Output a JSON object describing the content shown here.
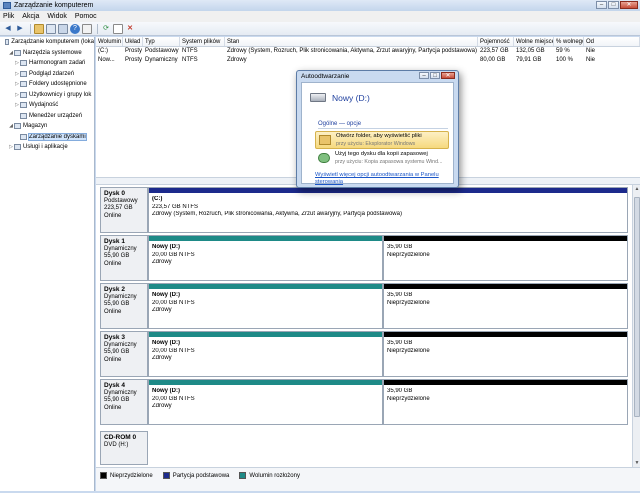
{
  "window": {
    "title": "Zarządzanie komputerem"
  },
  "menu": [
    "Plik",
    "Akcja",
    "Widok",
    "Pomoc"
  ],
  "toolbar": {
    "icons": [
      "back-icon",
      "forward-icon",
      "up-icon",
      "console-tree-icon",
      "properties-icon",
      "help-icon",
      "export-icon",
      "refresh-icon",
      "new-icon",
      "delete-icon"
    ]
  },
  "tree": {
    "items": [
      {
        "label": "Zarządzanie komputerem (loka",
        "indent": 0,
        "exp": ""
      },
      {
        "label": "Narzędzia systemowe",
        "indent": 1,
        "exp": "◢"
      },
      {
        "label": "Harmonogram zadań",
        "indent": 2,
        "exp": "▷"
      },
      {
        "label": "Podgląd zdarzeń",
        "indent": 2,
        "exp": "▷"
      },
      {
        "label": "Foldery udostępnione",
        "indent": 2,
        "exp": "▷"
      },
      {
        "label": "Użytkownicy i grupy lok",
        "indent": 2,
        "exp": "▷"
      },
      {
        "label": "Wydajność",
        "indent": 2,
        "exp": "▷"
      },
      {
        "label": "Menedżer urządzeń",
        "indent": 2,
        "exp": ""
      },
      {
        "label": "Magazyn",
        "indent": 1,
        "exp": "◢"
      },
      {
        "label": "Zarządzanie dyskami",
        "indent": 2,
        "exp": "",
        "selected": true
      },
      {
        "label": "Usługi i aplikacje",
        "indent": 1,
        "exp": "▷"
      }
    ]
  },
  "volumes": {
    "columns": [
      "Wolumin",
      "Układ",
      "Typ",
      "System plików",
      "Stan",
      "Pojemność",
      "Wolne miejsce",
      "% wolnego",
      "Od"
    ],
    "rows": [
      [
        "(C:)",
        "Prosty",
        "Podstawowy",
        "NTFS",
        "Zdrowy (System, Rozruch, Plik stronicowania, Aktywna, Zrzut awaryjny, Partycja podstawowa)",
        "223,57 GB",
        "132,05 GB",
        "59 %",
        "Nie"
      ],
      [
        "Now...",
        "Prosty",
        "Dynamiczny",
        "NTFS",
        "Zdrowy",
        "80,00 GB",
        "79,91 GB",
        "100 %",
        "Nie"
      ]
    ]
  },
  "disks": [
    {
      "name": "Dysk 0",
      "type": "Podstawowy",
      "size": "223,57 GB",
      "status": "Online",
      "partitions": [
        {
          "name": "(C:)",
          "fs": "223,57 GB NTFS",
          "state": "Zdrowy (System, Rozruch, Plik stronicowania, Aktywna, Zrzut awaryjny, Partycja podstawowa)",
          "kind": "primary",
          "share": 1.0
        }
      ]
    },
    {
      "name": "Dysk 1",
      "type": "Dynamiczny",
      "size": "55,90 GB",
      "status": "Online",
      "partitions": [
        {
          "name": "Nowy  (D:)",
          "fs": "20,00 GB NTFS",
          "state": "Zdrowy",
          "kind": "spanned",
          "share": 0.49
        },
        {
          "name": "",
          "fs": "35,90 GB",
          "state": "Nieprzydzielone",
          "kind": "unallocated",
          "share": 0.51
        }
      ]
    },
    {
      "name": "Dysk 2",
      "type": "Dynamiczny",
      "size": "55,90 GB",
      "status": "Online",
      "partitions": [
        {
          "name": "Nowy  (D:)",
          "fs": "20,00 GB NTFS",
          "state": "Zdrowy",
          "kind": "spanned",
          "share": 0.49
        },
        {
          "name": "",
          "fs": "35,90 GB",
          "state": "Nieprzydzielone",
          "kind": "unallocated",
          "share": 0.51
        }
      ]
    },
    {
      "name": "Dysk 3",
      "type": "Dynamiczny",
      "size": "55,90 GB",
      "status": "Online",
      "partitions": [
        {
          "name": "Nowy  (D:)",
          "fs": "20,00 GB NTFS",
          "state": "Zdrowy",
          "kind": "spanned",
          "share": 0.49
        },
        {
          "name": "",
          "fs": "35,90 GB",
          "state": "Nieprzydzielone",
          "kind": "unallocated",
          "share": 0.51
        }
      ]
    },
    {
      "name": "Dysk 4",
      "type": "Dynamiczny",
      "size": "55,90 GB",
      "status": "Online",
      "partitions": [
        {
          "name": "Nowy  (D:)",
          "fs": "20,00 GB NTFS",
          "state": "Zdrowy",
          "kind": "spanned",
          "share": 0.49
        },
        {
          "name": "",
          "fs": "35,90 GB",
          "state": "Nieprzydzielone",
          "kind": "unallocated",
          "share": 0.51
        }
      ]
    },
    {
      "name": "CD-ROM 0",
      "type": "DVD (H:)",
      "size": "",
      "status": "",
      "partitions": []
    }
  ],
  "legend": [
    {
      "label": "Nieprzydzielone",
      "color": "#000000"
    },
    {
      "label": "Partycja podstawowa",
      "color": "#1c2a8c"
    },
    {
      "label": "Wolumin rozłożony",
      "color": "#1e8a87"
    }
  ],
  "colors": {
    "primary": "#1c2a8c",
    "spanned": "#1e8a87",
    "unallocated": "#000000"
  },
  "autoplay": {
    "title": "Autoodtwarzanie",
    "drive": "Nowy (D:)",
    "section": "Ogólne — opcje",
    "options": [
      {
        "line1": "Otwórz folder, aby wyświetlić pliki",
        "line2": "przy użyciu: Eksplorator Windows"
      },
      {
        "line1": "Użyj tego dysku dla kopii zapasowej",
        "line2": "przy użyciu: Kopia zapasowa systemu Wind..."
      }
    ],
    "link": "Wyświetl więcej opcji autoodtwarzania w Panelu sterowania"
  }
}
